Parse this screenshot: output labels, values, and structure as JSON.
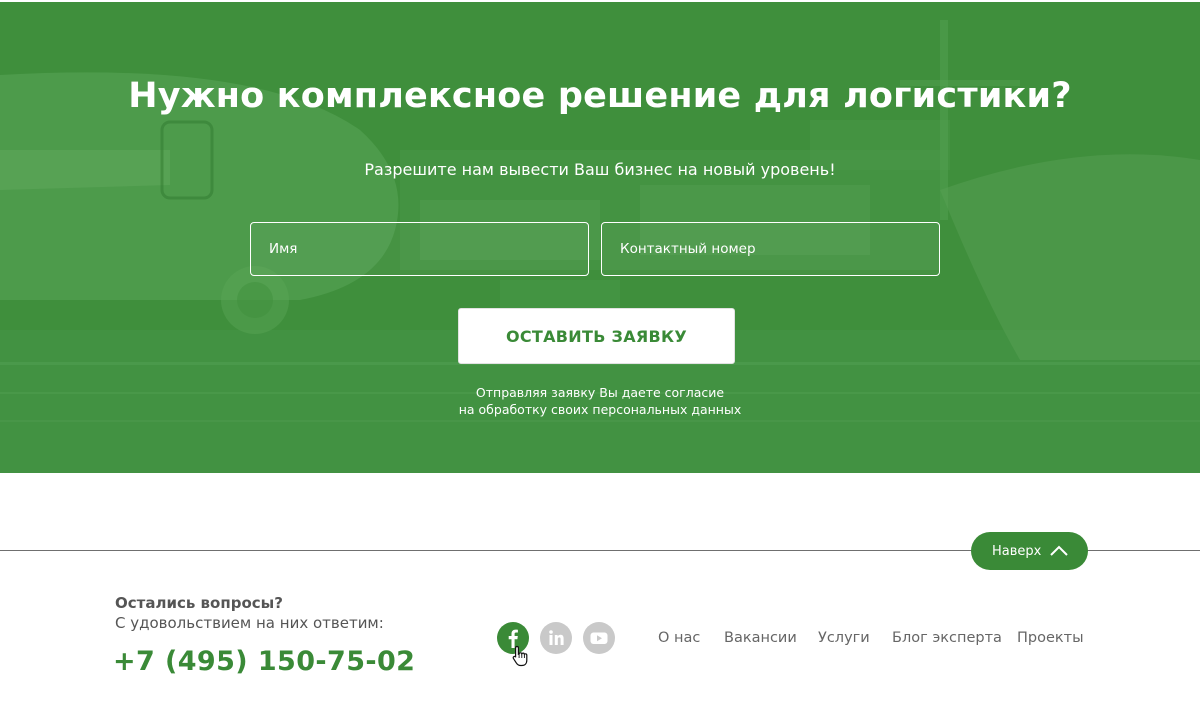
{
  "hero": {
    "title": "Нужно комплексное решение для логистики?",
    "subtitle": "Разрешите нам вывести Ваш бизнес на новый уровень!",
    "form": {
      "name_placeholder": "Имя",
      "phone_placeholder": "Контактный номер",
      "submit_label": "ОСТАВИТЬ ЗАЯВКУ"
    },
    "consent_line1": "Отправляя заявку Вы даете согласие",
    "consent_line2": "на обработку своих персональных данных"
  },
  "footer": {
    "scroll_top_label": "Наверх",
    "questions_title": "Остались вопросы?",
    "questions_subtitle": "С удовольствием на них ответим:",
    "phone": "+7 (495) 150-75-02",
    "social": [
      {
        "name": "facebook",
        "icon": "facebook-icon",
        "active": true
      },
      {
        "name": "linkedin",
        "icon": "linkedin-icon",
        "active": false
      },
      {
        "name": "youtube",
        "icon": "youtube-icon",
        "active": false
      }
    ],
    "nav": [
      {
        "label": "О нас"
      },
      {
        "label": "Вакансии"
      },
      {
        "label": "Услуги"
      },
      {
        "label": "Блог эксперта"
      },
      {
        "label": "Проекты"
      }
    ]
  },
  "colors": {
    "brand_green": "#3a8a37",
    "hero_overlay": "#3f8f3c",
    "text_gray": "#555555",
    "icon_gray": "#c9c9c9"
  }
}
